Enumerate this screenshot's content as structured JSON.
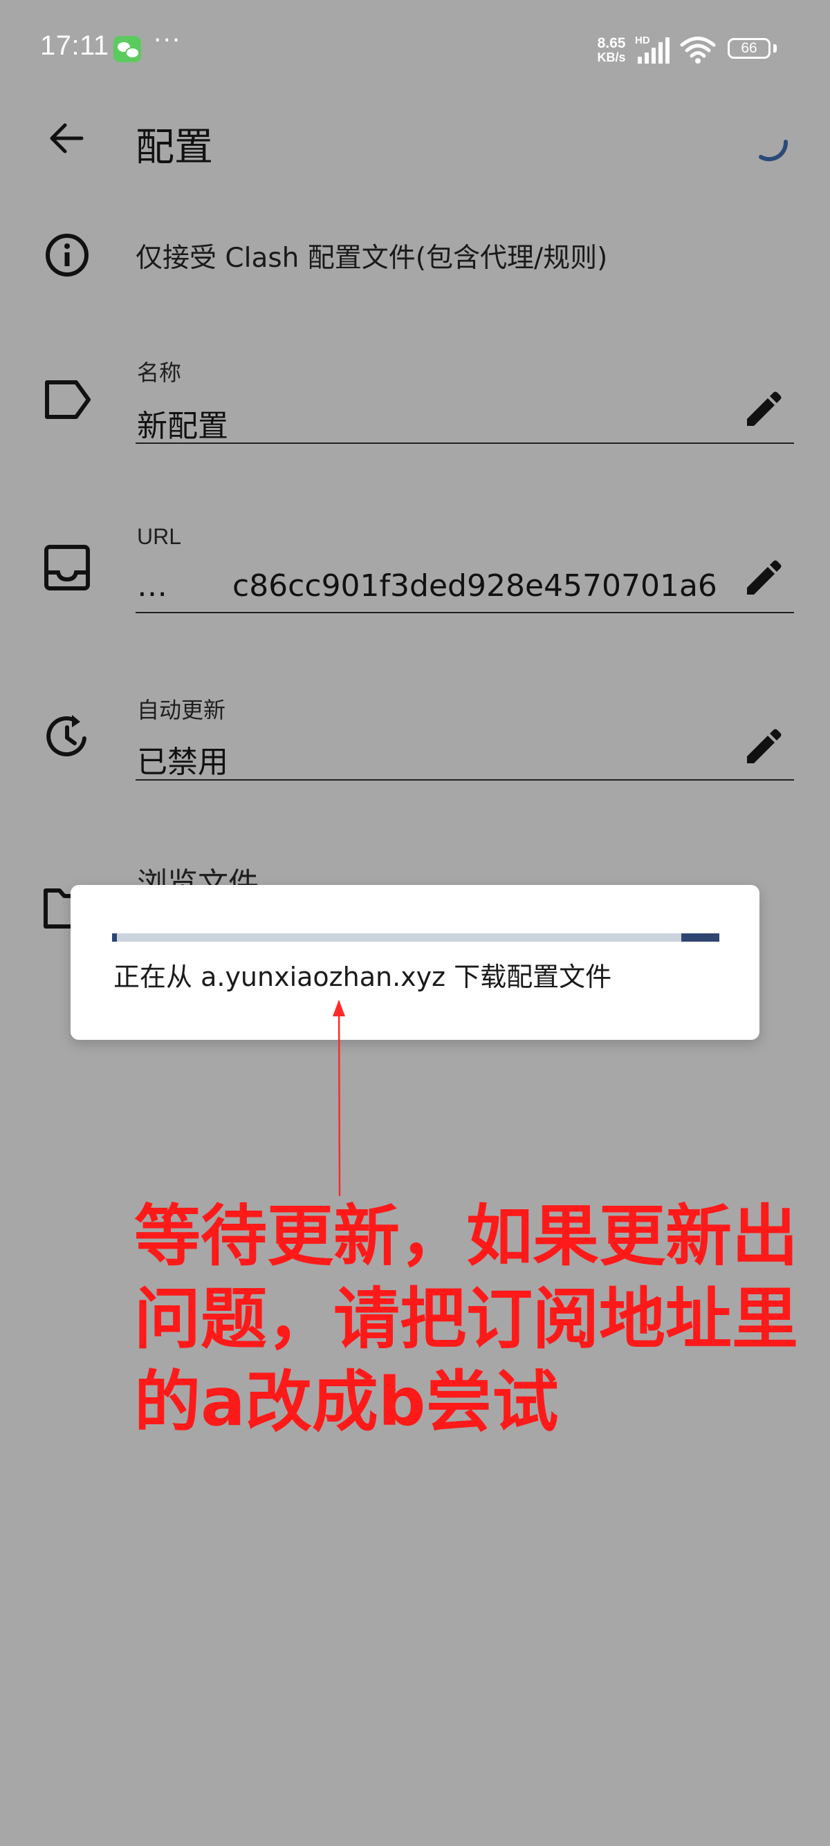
{
  "status_bar": {
    "time": "17:11",
    "more_dots": "···",
    "net_speed_value": "8.65",
    "net_speed_unit": "KB/s",
    "signal_badge": "HD",
    "battery_level": "66",
    "icons": [
      "wechat-icon",
      "cell-signal-icon",
      "wifi-icon",
      "battery-icon"
    ]
  },
  "app_bar": {
    "title": "配置",
    "back_icon": "arrow-left-icon",
    "loading_icon": "spinner-icon"
  },
  "info": {
    "icon": "info-icon",
    "text": "仅接受 Clash 配置文件(包含代理/规则)"
  },
  "fields": {
    "name": {
      "icon": "tag-icon",
      "label": "名称",
      "value": "新配置"
    },
    "url": {
      "icon": "inbox-icon",
      "label": "URL",
      "prefix": "…",
      "value": "c86cc901f3ded928e4570701a6"
    },
    "auto_update": {
      "icon": "history-icon",
      "label": "自动更新",
      "value": "已禁用"
    },
    "browse": {
      "icon": "folder-icon",
      "label": "浏览文件"
    }
  },
  "dialog": {
    "message": "正在从 a.yunxiaozhan.xyz 下载配置文件"
  },
  "annotation": {
    "text": "等待更新，如果更新出问题，请把订阅地址里的a改成b尝试",
    "color": "#ff1a1a"
  },
  "colors": {
    "background_scrim": "#a7a7a7",
    "dialog_bg": "#ffffff",
    "progress_track": "#cbd3dc",
    "progress_fill": "#2e4570",
    "spinner": "#2c4a78"
  }
}
